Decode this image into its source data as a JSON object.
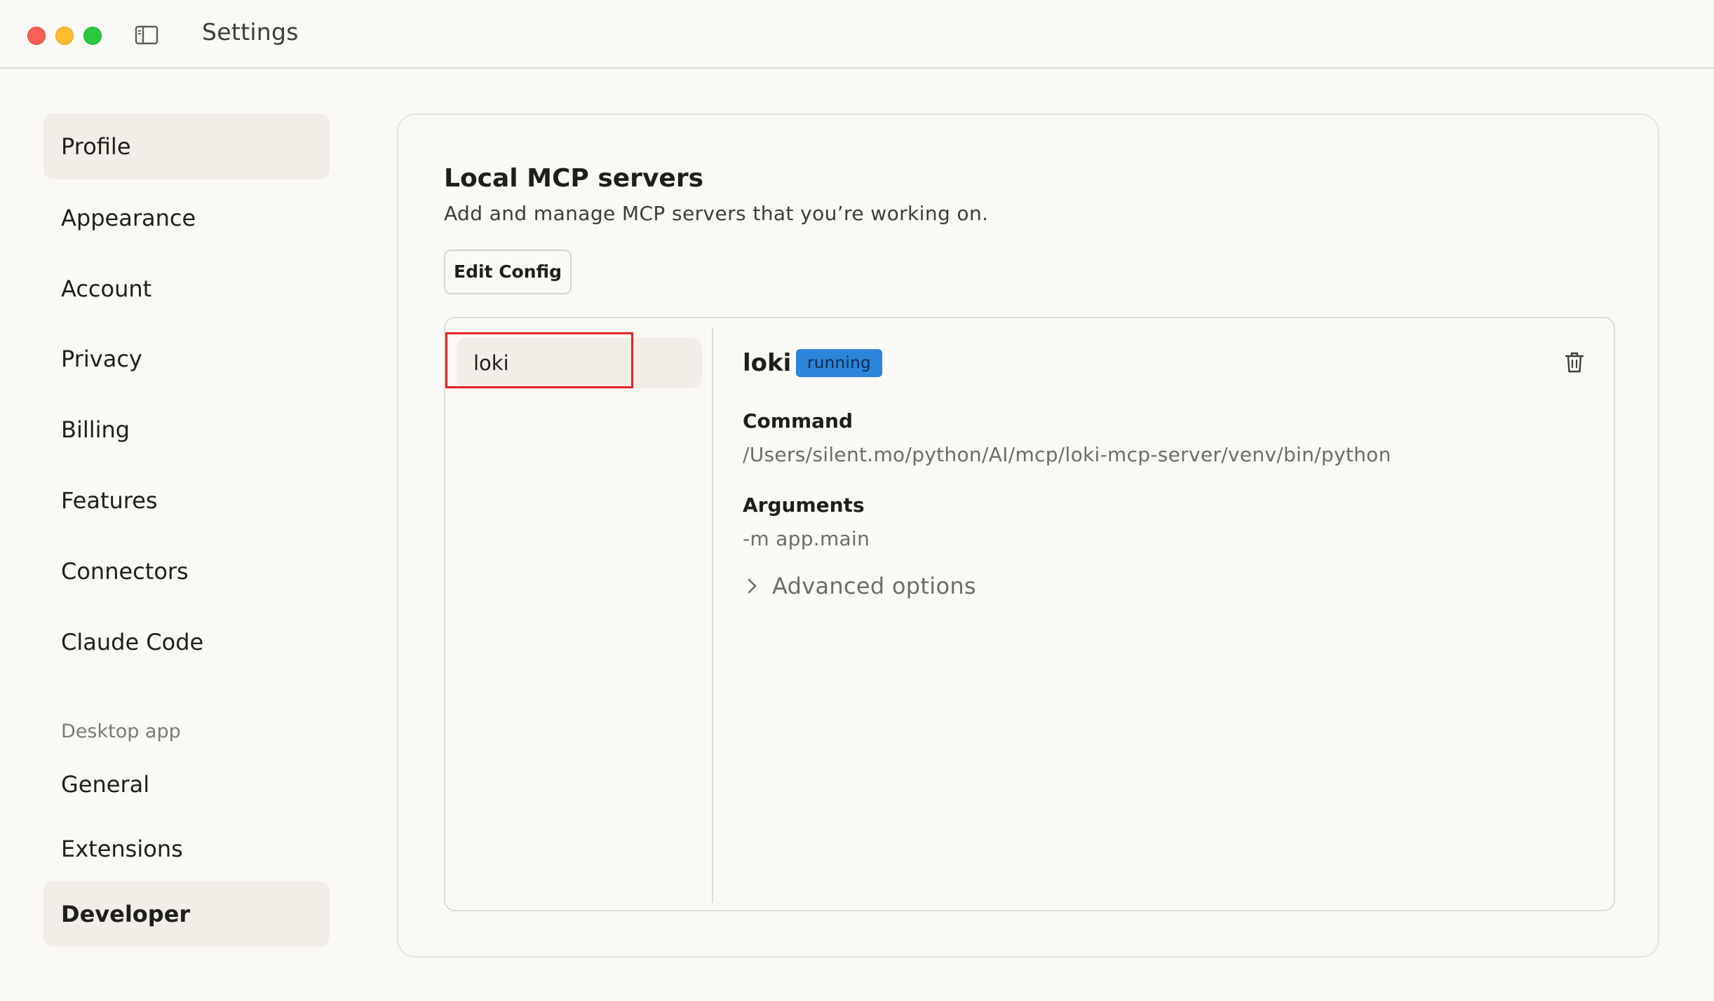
{
  "window": {
    "title": "Settings"
  },
  "sidebar": {
    "items": [
      {
        "label": "Profile"
      },
      {
        "label": "Appearance"
      },
      {
        "label": "Account"
      },
      {
        "label": "Privacy"
      },
      {
        "label": "Billing"
      },
      {
        "label": "Features"
      },
      {
        "label": "Connectors"
      },
      {
        "label": "Claude Code"
      }
    ],
    "section_label": "Desktop app",
    "desktop_items": [
      {
        "label": "General"
      },
      {
        "label": "Extensions"
      },
      {
        "label": "Developer"
      }
    ],
    "active": "Developer"
  },
  "main": {
    "title": "Local MCP servers",
    "subtitle": "Add and manage MCP servers that you’re working on.",
    "edit_config_label": "Edit Config",
    "servers": [
      {
        "name": "loki"
      }
    ],
    "selected_server": {
      "name": "loki",
      "status": "running",
      "command_label": "Command",
      "command_value": "/Users/silent.mo/python/AI/mcp/loki-mcp-server/venv/bin/python",
      "arguments_label": "Arguments",
      "arguments_value": "-m app.main",
      "advanced_label": "Advanced options"
    }
  },
  "colors": {
    "background": "#faf9f5",
    "active_nav": "#f0eee6",
    "status_badge": "#2c84db",
    "annotation_box": "#e02424"
  },
  "icons": [
    "sidebar-toggle-icon",
    "trash-icon",
    "chevron-right-icon"
  ]
}
